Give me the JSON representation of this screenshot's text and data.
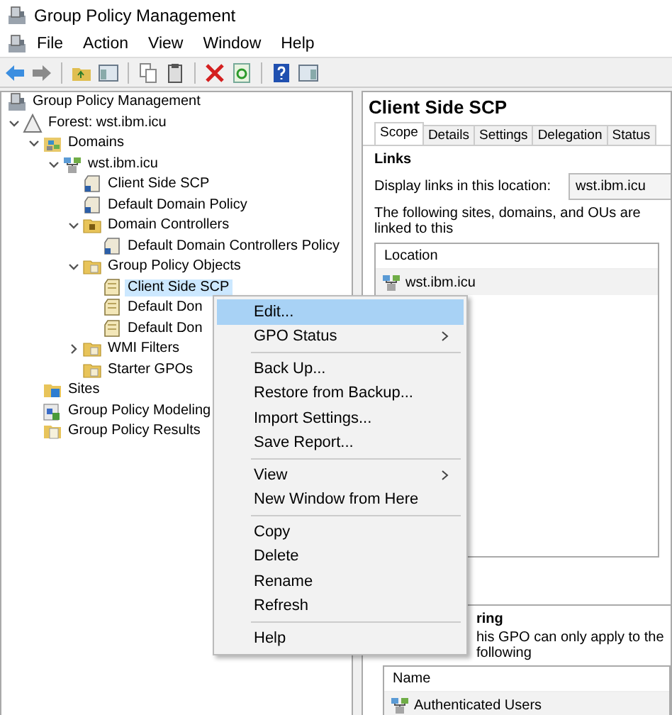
{
  "window": {
    "title": "Group Policy Management"
  },
  "menu_bar": [
    "File",
    "Action",
    "View",
    "Window",
    "Help"
  ],
  "tree": [
    {
      "label": "Group Policy Management",
      "kind": "console",
      "selected": false,
      "children": [
        {
          "label": "Forest: wst.ibm.icu",
          "kind": "forest",
          "expanded": true,
          "selected": false,
          "children": [
            {
              "label": "Domains",
              "kind": "domains",
              "expanded": true,
              "selected": false,
              "children": [
                {
                  "label": "wst.ibm.icu",
                  "kind": "domain",
                  "expanded": true,
                  "selected": false,
                  "children": [
                    {
                      "label": "Client Side SCP",
                      "kind": "link",
                      "selected": false
                    },
                    {
                      "label": "Default Domain Policy",
                      "kind": "link",
                      "selected": false
                    },
                    {
                      "label": "Domain Controllers",
                      "kind": "ou",
                      "expanded": true,
                      "selected": false,
                      "children": [
                        {
                          "label": "Default Domain Controllers Policy",
                          "kind": "link",
                          "selected": false
                        }
                      ]
                    },
                    {
                      "label": "Group Policy Objects",
                      "kind": "folder",
                      "expanded": true,
                      "selected": false,
                      "children": [
                        {
                          "label": "Client Side SCP",
                          "kind": "gpo",
                          "selected": true
                        },
                        {
                          "label": "Default Don",
                          "kind": "gpo",
                          "selected": false
                        },
                        {
                          "label": "Default Don",
                          "kind": "gpo",
                          "selected": false
                        }
                      ]
                    },
                    {
                      "label": "WMI Filters",
                      "kind": "folder",
                      "expanded": false,
                      "selected": false
                    },
                    {
                      "label": "Starter GPOs",
                      "kind": "folder",
                      "selected": false
                    }
                  ]
                }
              ]
            },
            {
              "label": "Sites",
              "kind": "sites",
              "selected": false
            },
            {
              "label": "Group Policy Modeling",
              "kind": "modeling",
              "selected": false
            },
            {
              "label": "Group Policy Results",
              "kind": "results",
              "selected": false
            }
          ]
        }
      ]
    }
  ],
  "details": {
    "title": "Client Side SCP",
    "tabs": [
      {
        "label": "Scope",
        "selected": true
      },
      {
        "label": "Details",
        "selected": false
      },
      {
        "label": "Settings",
        "selected": false
      },
      {
        "label": "Delegation",
        "selected": false
      },
      {
        "label": "Status",
        "selected": false
      }
    ],
    "links_heading": "Links",
    "display_label": "Display links in this location:",
    "location_value": "wst.ibm.icu",
    "linked_note": "The following sites, domains, and OUs are linked to this",
    "links_table": {
      "columns": [
        "Location"
      ],
      "rows": [
        [
          "wst.ibm.icu"
        ]
      ]
    },
    "filter_heading": "ring",
    "filter_note": "his GPO can only apply to the following",
    "filter_table": {
      "columns": [
        "Name"
      ],
      "rows": [
        [
          "Authenticated Users"
        ]
      ]
    }
  },
  "context_menu": [
    {
      "kind": "item",
      "label": "Edit...",
      "submenu": false,
      "selected": true
    },
    {
      "kind": "item",
      "label": "GPO Status",
      "submenu": true,
      "selected": false
    },
    {
      "kind": "separator"
    },
    {
      "kind": "item",
      "label": "Back Up...",
      "submenu": false,
      "selected": false
    },
    {
      "kind": "item",
      "label": "Restore from Backup...",
      "submenu": false,
      "selected": false
    },
    {
      "kind": "item",
      "label": "Import Settings...",
      "submenu": false,
      "selected": false
    },
    {
      "kind": "item",
      "label": "Save Report...",
      "submenu": false,
      "selected": false
    },
    {
      "kind": "separator"
    },
    {
      "kind": "item",
      "label": "View",
      "submenu": true,
      "selected": false
    },
    {
      "kind": "item",
      "label": "New Window from Here",
      "submenu": false,
      "selected": false
    },
    {
      "kind": "separator"
    },
    {
      "kind": "item",
      "label": "Copy",
      "submenu": false,
      "selected": false
    },
    {
      "kind": "item",
      "label": "Delete",
      "submenu": false,
      "selected": false
    },
    {
      "kind": "item",
      "label": "Rename",
      "submenu": false,
      "selected": false
    },
    {
      "kind": "item",
      "label": "Refresh",
      "submenu": false,
      "selected": false
    },
    {
      "kind": "separator"
    },
    {
      "kind": "item",
      "label": "Help",
      "submenu": false,
      "selected": false
    }
  ]
}
